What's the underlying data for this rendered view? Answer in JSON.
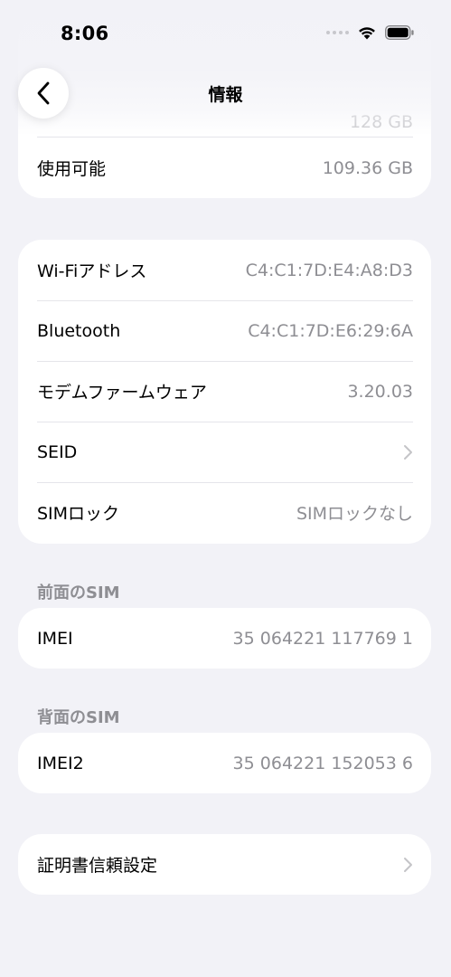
{
  "status_bar": {
    "time": "8:06"
  },
  "nav": {
    "title": "情報"
  },
  "storage": {
    "capacity_value": "128 GB",
    "available_label": "使用可能",
    "available_value": "109.36 GB"
  },
  "network": [
    {
      "label": "Wi-Fiアドレス",
      "value": "C4:C1:7D:E4:A8:D3"
    },
    {
      "label": "Bluetooth",
      "value": "C4:C1:7D:E6:29:6A"
    },
    {
      "label": "モデムファームウェア",
      "value": "3.20.03"
    },
    {
      "label": "SEID",
      "value": ""
    },
    {
      "label": "SIMロック",
      "value": "SIMロックなし"
    }
  ],
  "front_sim": {
    "header": "前面のSIM",
    "label": "IMEI",
    "value": "35 064221 117769 1"
  },
  "back_sim": {
    "header": "背面のSIM",
    "label": "IMEI2",
    "value": "35 064221 152053 6"
  },
  "certificate": {
    "label": "証明書信頼設定"
  }
}
